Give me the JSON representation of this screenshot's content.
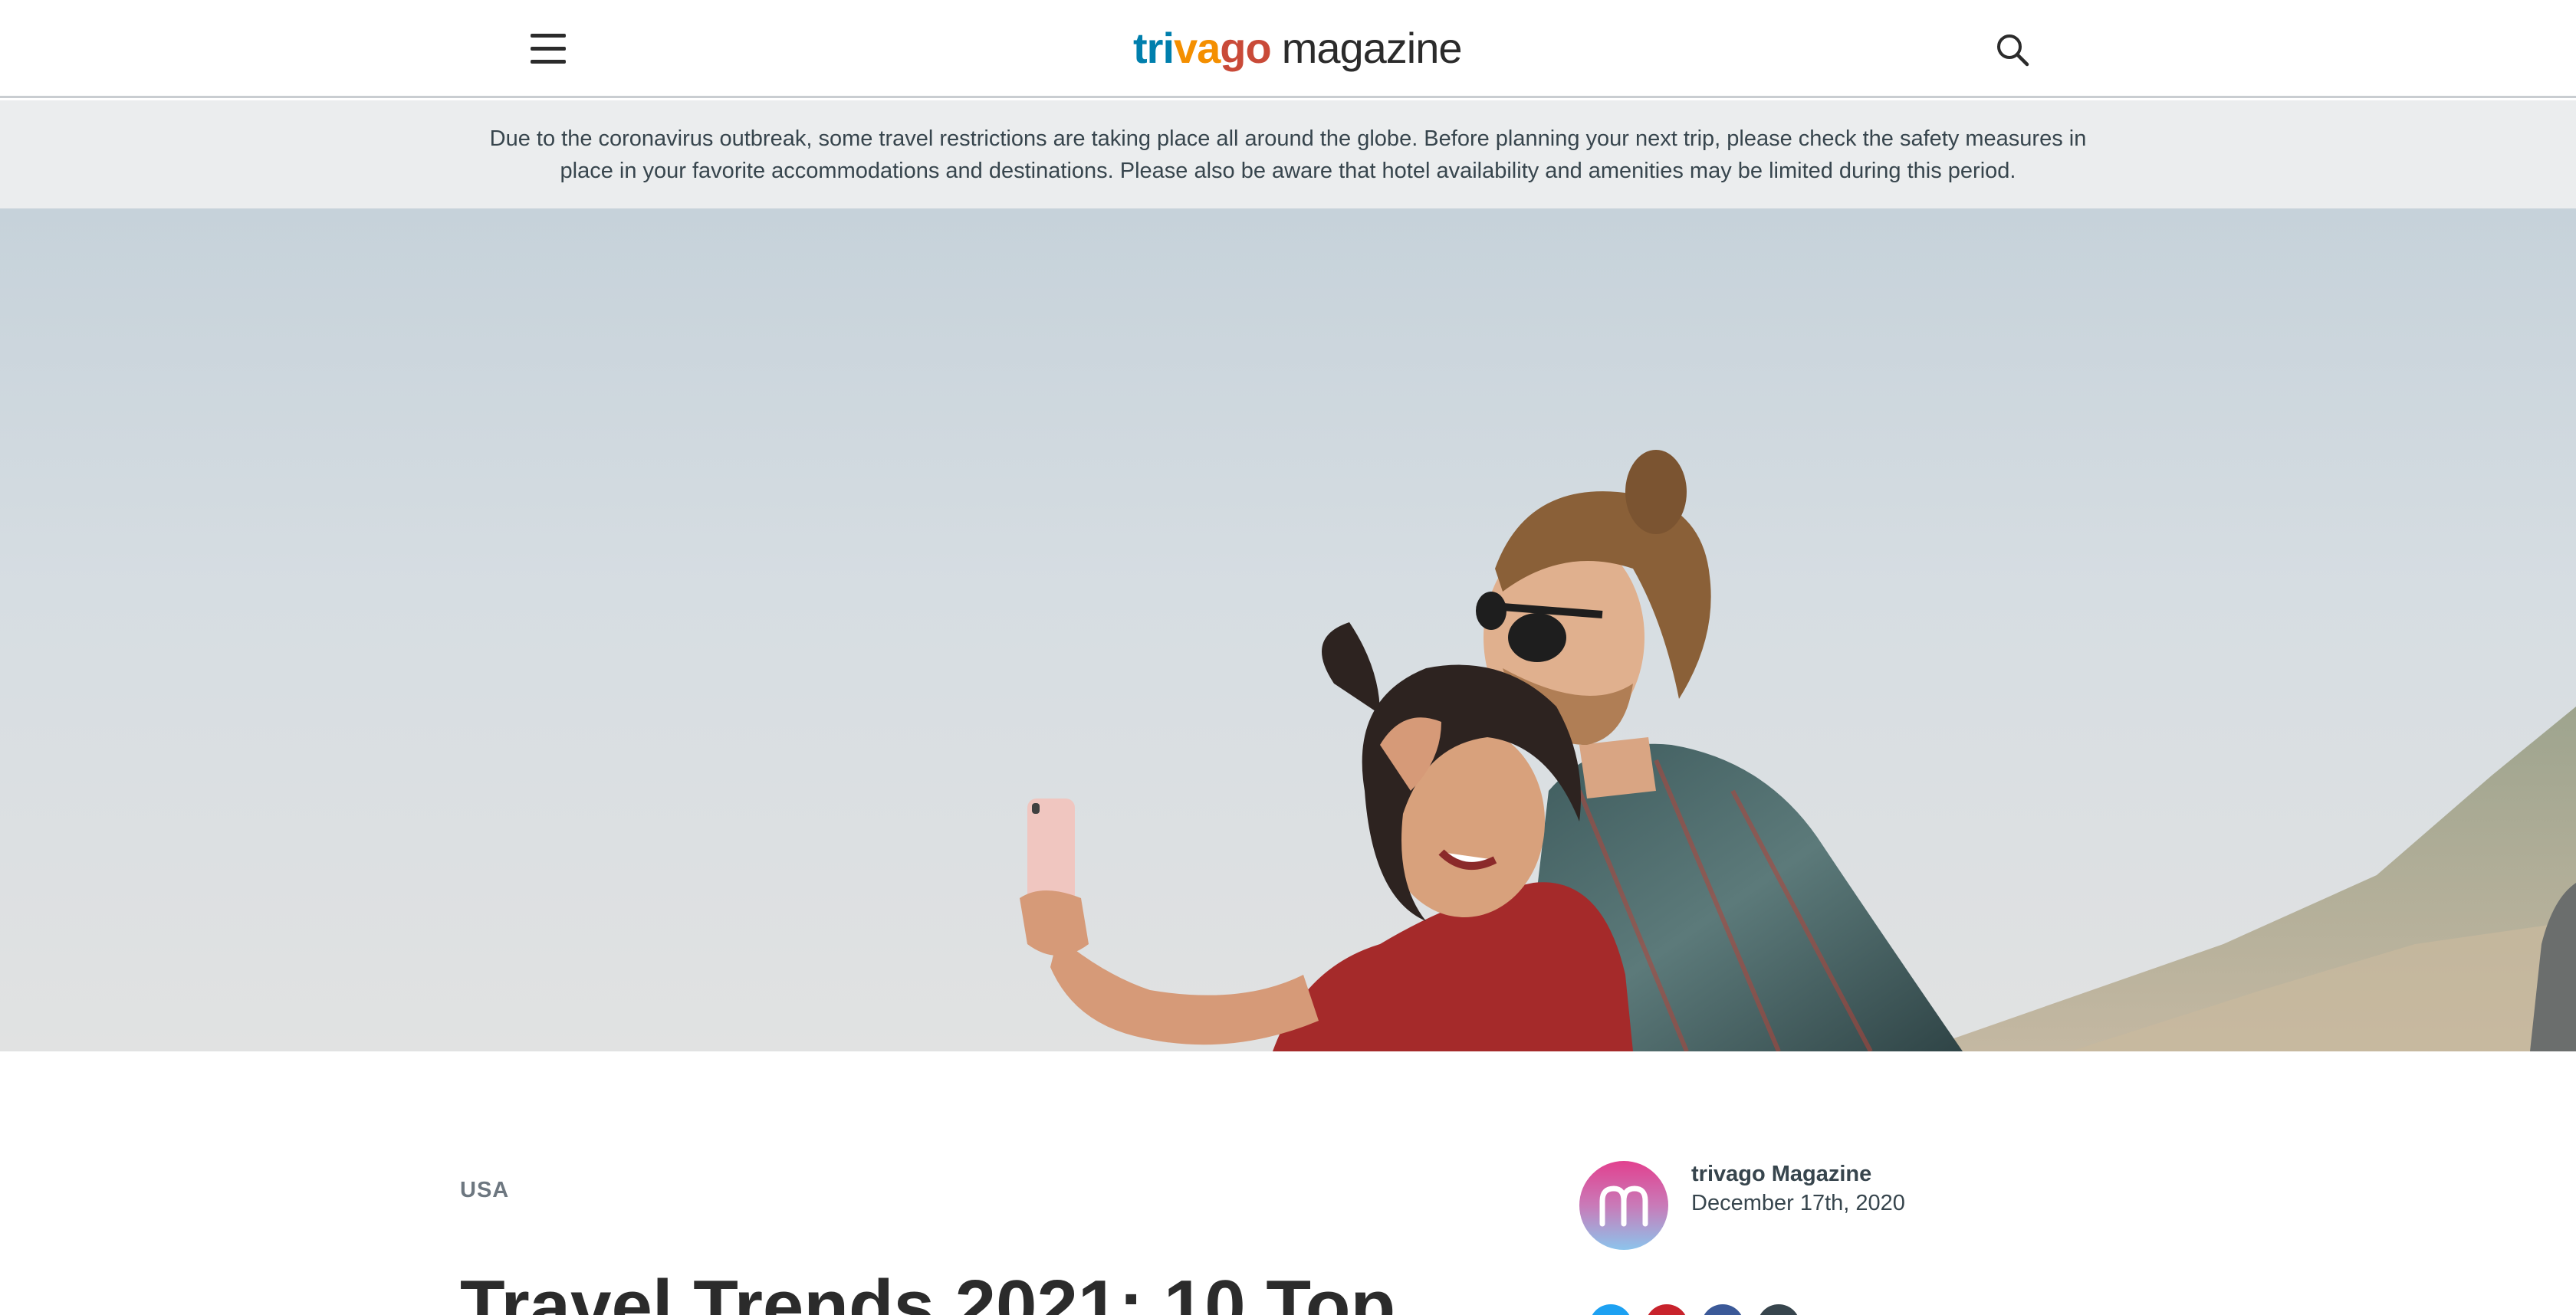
{
  "header": {
    "logo": {
      "brand_parts": [
        "tri",
        "va",
        "go"
      ],
      "word": "magazine"
    },
    "menu_icon": "hamburger-menu-icon",
    "search_icon": "search-icon"
  },
  "notice": {
    "text": "Due to the coronavirus outbreak, some travel restrictions are taking place all around the globe. Before planning your next trip, please check the safety measures in place in your favorite accommodations and destinations. Please also be aware that hotel availability and amenities may be limited during this period."
  },
  "colors": {
    "logo_blue": "#007fad",
    "logo_orange": "#f48f00",
    "logo_red": "#c94a38",
    "notice_bg": "#ebedee",
    "text": "#37454d"
  },
  "article": {
    "category": "USA",
    "title": "Travel Trends 2021: 10 Top",
    "author": {
      "name": "trivago Magazine",
      "date": "December 17th, 2020",
      "avatar_letter": "m"
    },
    "share_icons": [
      "twitter-icon",
      "pinterest-icon",
      "facebook-icon",
      "mail-icon"
    ]
  }
}
